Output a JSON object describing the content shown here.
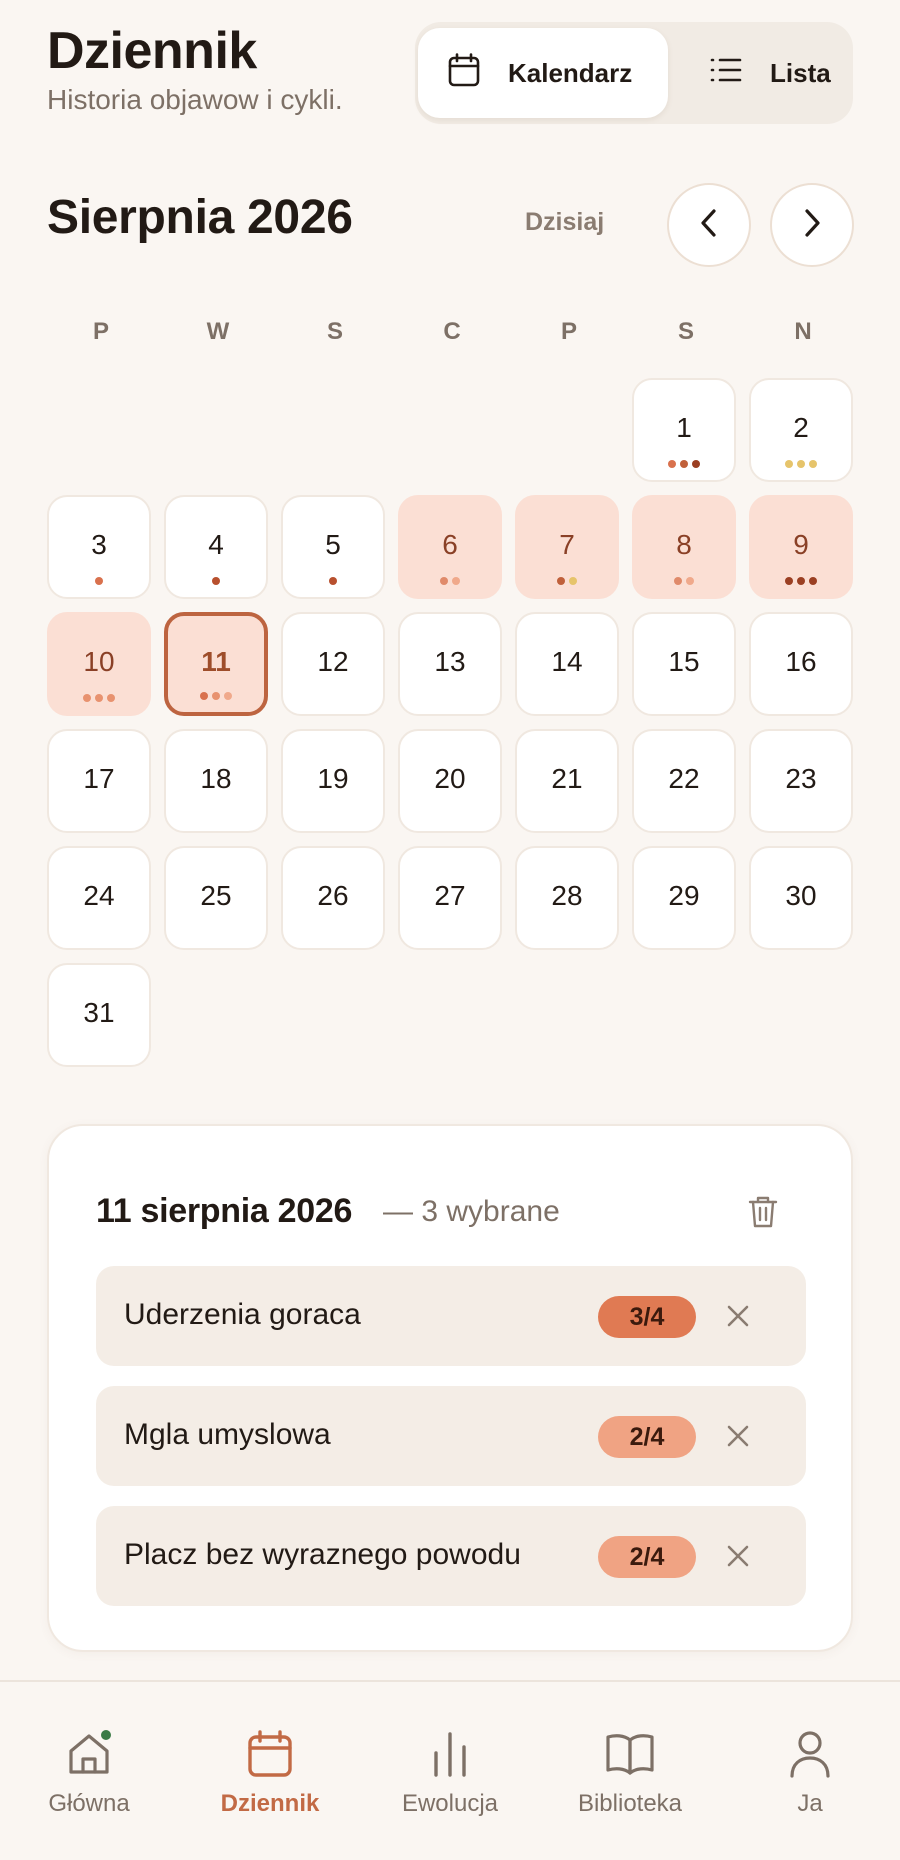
{
  "header": {
    "title": "Dziennik",
    "subtitle": "Historia objawow i cykli."
  },
  "view_toggle": {
    "calendar_label": "Kalendarz",
    "list_label": "Lista",
    "selected": "Kalendarz"
  },
  "calendar": {
    "month_label": "Sierpnia 2026",
    "today_label": "Dzisiaj",
    "weekdays": [
      "P",
      "W",
      "S",
      "C",
      "P",
      "S",
      "N"
    ],
    "first_weekday_index": 5,
    "days_in_month": 31,
    "selected_day": 11,
    "highlighted_days": [
      6,
      7,
      8,
      9,
      10
    ],
    "day_dots": {
      "1": [
        "#d9714d",
        "#c0603a",
        "#9b3f22"
      ],
      "2": [
        "#e6c46b",
        "#e6c46b",
        "#e6c46b"
      ],
      "3": [
        "#d9714d"
      ],
      "4": [
        "#b8502e"
      ],
      "5": [
        "#b8502e"
      ],
      "6": [
        "#e08a6a",
        "#f0a98b"
      ],
      "7": [
        "#c0603a",
        "#e6c46b"
      ],
      "8": [
        "#e08a6a",
        "#f0a98b"
      ],
      "9": [
        "#9b3f22",
        "#9b3f22",
        "#9b3f22"
      ],
      "10": [
        "#e8926f",
        "#e8926f",
        "#e8926f"
      ],
      "11": [
        "#d9714d",
        "#e8926f",
        "#f0a98b"
      ]
    }
  },
  "detail": {
    "date_label": "11 sierpnia 2026",
    "count_label": "— 3 wybrane",
    "symptoms": [
      {
        "name": "Uderzenia goraca",
        "severity": "3/4",
        "color": "#e07a53"
      },
      {
        "name": "Mgla umyslowa",
        "severity": "2/4",
        "color": "#f0a383"
      },
      {
        "name": "Placz bez wyraznego powodu",
        "severity": "2/4",
        "color": "#f0a383"
      }
    ]
  },
  "bottom_nav": {
    "items": [
      {
        "label": "Główna",
        "icon": "home-icon"
      },
      {
        "label": "Dziennik",
        "icon": "calendar-icon"
      },
      {
        "label": "Ewolucja",
        "icon": "bar-chart-icon"
      },
      {
        "label": "Biblioteka",
        "icon": "book-icon"
      },
      {
        "label": "Ja",
        "icon": "user-icon"
      }
    ],
    "active": "Dziennik"
  },
  "colors": {
    "accent": "#c26a45",
    "background": "#faf6f2",
    "tint": "#fbdfd4",
    "notification": "#3a7a46"
  }
}
